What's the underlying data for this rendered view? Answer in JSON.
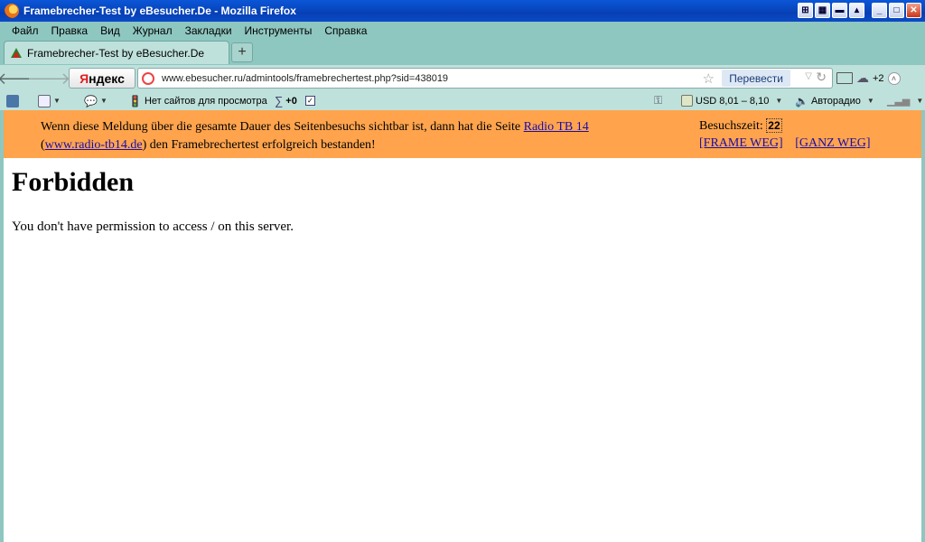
{
  "window": {
    "title": "Framebrecher-Test by eBesucher.De - Mozilla Firefox"
  },
  "menu": [
    "Файл",
    "Правка",
    "Вид",
    "Журнал",
    "Закладки",
    "Инструменты",
    "Справка"
  ],
  "tab": {
    "label": "Framebrecher-Test by eBesucher.De",
    "new_tab": "+"
  },
  "navbar": {
    "yandex_y": "Я",
    "yandex_rest": "ндекс",
    "url": "www.ebesucher.ru/admintools/framebrechertest.php?sid=438019",
    "translate": "Перевести",
    "extra_count": "+2"
  },
  "ybar": {
    "no_sites": "Нет сайтов для просмотра",
    "sum_value": "+0",
    "currency": "USD 8,01 – 8,10",
    "radio": "Авторадио"
  },
  "banner": {
    "msg_before": "Wenn diese Meldung über die gesamte Dauer des Seitenbesuchs sichtbar ist, dann hat die Seite ",
    "link_name": "Radio TB 14",
    "paren_open": "(",
    "link_url": "www.radio-tb14.de",
    "msg_after": ") den Framebrechertest erfolgreich bestanden!",
    "timer_label": "Besuchszeit: ",
    "timer_value": "22",
    "frame_weg": "[FRAME WEG]",
    "ganz_weg": "[GANZ WEG]"
  },
  "page": {
    "heading": "Forbidden",
    "text": "You don't have permission to access / on this server."
  },
  "colors": {
    "chrome": "#8ec6c0",
    "toolbar": "#bfe1db",
    "banner": "#ffa44d",
    "title_bar": "#0a57d8"
  }
}
